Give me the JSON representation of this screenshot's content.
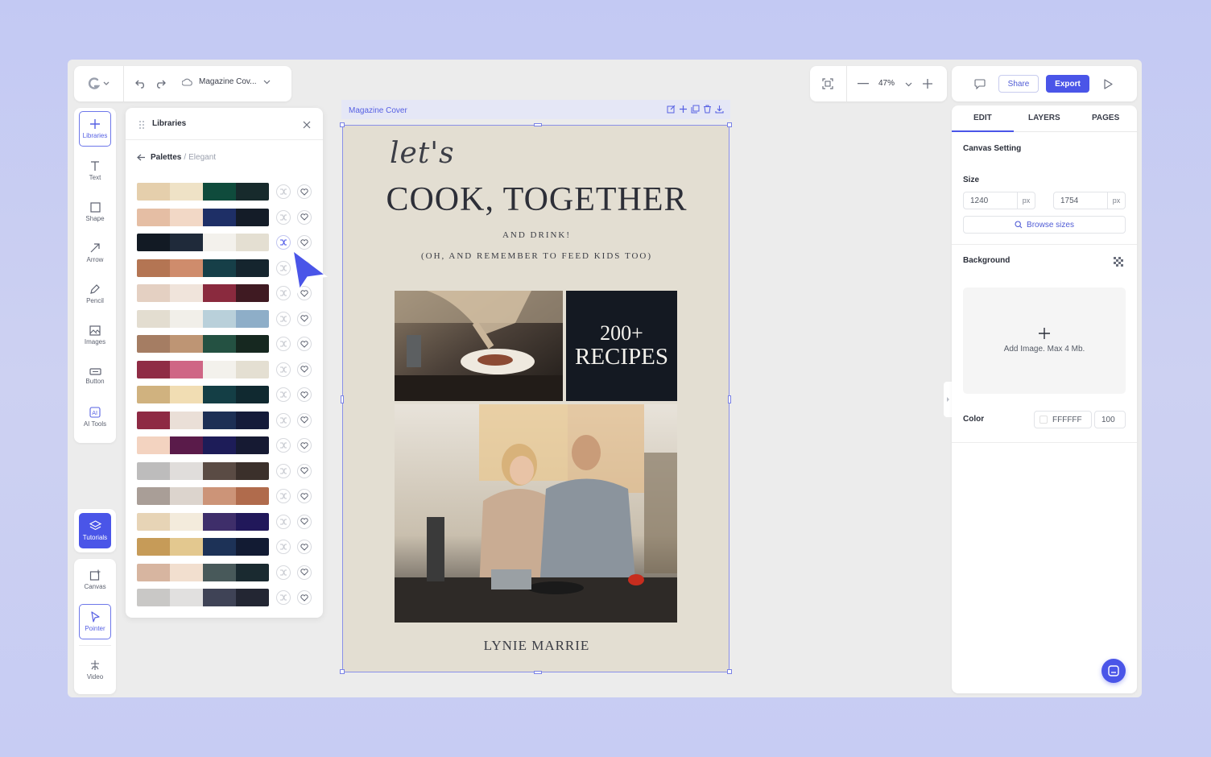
{
  "topbar": {
    "doc_title": "Magazine Cov...",
    "zoom": "47%",
    "share_label": "Share",
    "export_label": "Export"
  },
  "tools": [
    {
      "label": "Libraries",
      "icon": "plus-icon"
    },
    {
      "label": "Text",
      "icon": "text-icon"
    },
    {
      "label": "Shape",
      "icon": "square-icon"
    },
    {
      "label": "Arrow",
      "icon": "arrow-icon"
    },
    {
      "label": "Pencil",
      "icon": "pencil-icon"
    },
    {
      "label": "Images",
      "icon": "image-icon"
    },
    {
      "label": "Button",
      "icon": "button-icon"
    },
    {
      "label": "AI Tools",
      "icon": "ai-icon"
    }
  ],
  "tutorials_label": "Tutorials",
  "bottom_tools": [
    {
      "label": "Canvas",
      "icon": "canvas-icon"
    },
    {
      "label": "Pointer",
      "icon": "pointer-icon"
    },
    {
      "label": "Video",
      "icon": "video-icon"
    }
  ],
  "libraries": {
    "title": "Libraries",
    "breadcrumb_current": "Palettes",
    "breadcrumb_sep": "/",
    "breadcrumb_sub": "Elegant",
    "palettes": [
      [
        "#e5cfac",
        "#efe2c6",
        "#0f4b3c",
        "#172a2c"
      ],
      [
        "#e5bea4",
        "#f2d8c6",
        "#1e2f66",
        "#141c28"
      ],
      [
        "#121a24",
        "#1f2a3a",
        "#f3f1ec",
        "#e4dfd2"
      ],
      [
        "#b47553",
        "#cf8c6c",
        "#163f48",
        "#15252e"
      ],
      [
        "#e4d0c2",
        "#f0e4db",
        "#8a2a3e",
        "#3f1a22"
      ],
      [
        "#e3ddd0",
        "#f1efe9",
        "#b9d0da",
        "#8eaec8"
      ],
      [
        "#a57d63",
        "#be9574",
        "#245142",
        "#162820"
      ],
      [
        "#8f2c45",
        "#cf6685",
        "#f3f1ec",
        "#e4dfd2"
      ],
      [
        "#d0b27f",
        "#f1ddb3",
        "#143e45",
        "#102930"
      ],
      [
        "#8e2a44",
        "#eadfd7",
        "#1d2f55",
        "#141b3a"
      ],
      [
        "#f3d3c0",
        "#5a1b4a",
        "#1d1c58",
        "#161a33"
      ],
      [
        "#bdbcbc",
        "#e0dddb",
        "#5a4b44",
        "#3b302b"
      ],
      [
        "#a99e97",
        "#dcd4cd",
        "#cc9478",
        "#b06b4c"
      ],
      [
        "#e7d4b6",
        "#f3ebdc",
        "#3e2e6a",
        "#21185a"
      ],
      [
        "#c69b58",
        "#e3c88f",
        "#1d3257",
        "#121b33"
      ],
      [
        "#d7b5a0",
        "#f2dfcf",
        "#48595a",
        "#1a2a30"
      ],
      [
        "#c9c8c6",
        "#e1e0df",
        "#3f4356",
        "#232633"
      ]
    ]
  },
  "canvas": {
    "label": "Magazine Cover",
    "script_text": "let's",
    "title": "COOK, TOGETHER",
    "subtitle1": "AND DRINK!",
    "subtitle2": "(OH, AND REMEMBER TO FEED KIDS TOO)",
    "recipes_count": "200+",
    "recipes_label": "RECIPES",
    "author": "LYNIE MARRIE",
    "bg_color": "#e3ded2"
  },
  "right_panel": {
    "tabs": [
      "EDIT",
      "LAYERS",
      "PAGES"
    ],
    "active_tab": "EDIT",
    "section_title": "Canvas Setting",
    "size_label": "Size",
    "width": "1240",
    "height": "1754",
    "unit": "px",
    "browse_label": "Browse sizes",
    "background_label": "Background",
    "add_image_label": "Add Image. Max 4 Mb.",
    "color_label": "Color",
    "color_value": "FFFFFF",
    "opacity_value": "100"
  },
  "colors": {
    "accent": "#4a55e8",
    "app_bg": "#ececec",
    "page_bg": "#c3c9f3"
  }
}
